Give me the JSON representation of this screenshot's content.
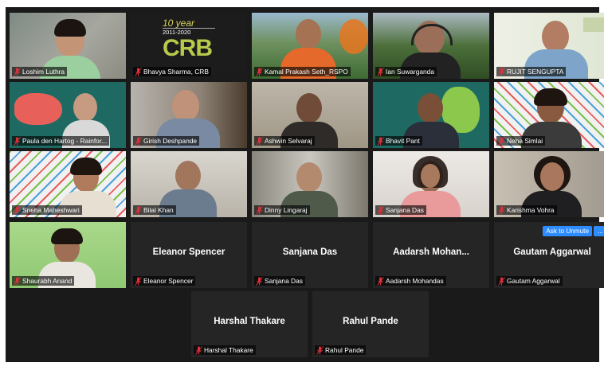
{
  "participants": [
    {
      "name": "Loshim Luthra",
      "display": ""
    },
    {
      "name": "Bhavya Sharma, CRB",
      "display": ""
    },
    {
      "name": "Kamal Prakash Seth_RSPO",
      "display": ""
    },
    {
      "name": "Ian Suwarganda",
      "display": ""
    },
    {
      "name": "RUJIT SENGUPTA",
      "display": ""
    },
    {
      "name": "Paula den Hartog - Rainfor...",
      "display": ""
    },
    {
      "name": "Girish Deshpande",
      "display": ""
    },
    {
      "name": "Ashwin Selvaraj",
      "display": ""
    },
    {
      "name": "Bhavit Pant",
      "display": ""
    },
    {
      "name": "Neha Simlai",
      "display": ""
    },
    {
      "name": "Sneha Maheshwari",
      "display": ""
    },
    {
      "name": "Bilal Khan",
      "display": ""
    },
    {
      "name": "Dinny Lingaraj",
      "display": ""
    },
    {
      "name": "Sanjana Das",
      "display": ""
    },
    {
      "name": "Karishma Vohra",
      "display": ""
    },
    {
      "name": "Shaurabh Anand",
      "display": ""
    },
    {
      "name": "Eleanor Spencer",
      "display": "Eleanor Spencer"
    },
    {
      "name": "Sanjana Das",
      "display": "Sanjana Das"
    },
    {
      "name": "Aadarsh Mohandas",
      "display": "Aadarsh  Mohan..."
    },
    {
      "name": "Gautam Aggarwal",
      "display": "Gautam Aggarwal"
    },
    {
      "name": "Harshal Thakare",
      "display": "Harshal Thakare"
    },
    {
      "name": "Rahul Pande",
      "display": "Rahul Pande"
    }
  ],
  "crb_logo": {
    "year_text": "10 year",
    "range_text": "2011-2020",
    "brand": "CRB"
  },
  "unmute_button": "Ask to Unmute",
  "more_button": "...",
  "colors": {
    "mic_muted": "#e0313a",
    "active_speaker": "#f0d41b",
    "button_blue": "#2d8cff",
    "tile_bg": "#252525"
  },
  "icons": {
    "mic": "microphone-muted-icon"
  }
}
